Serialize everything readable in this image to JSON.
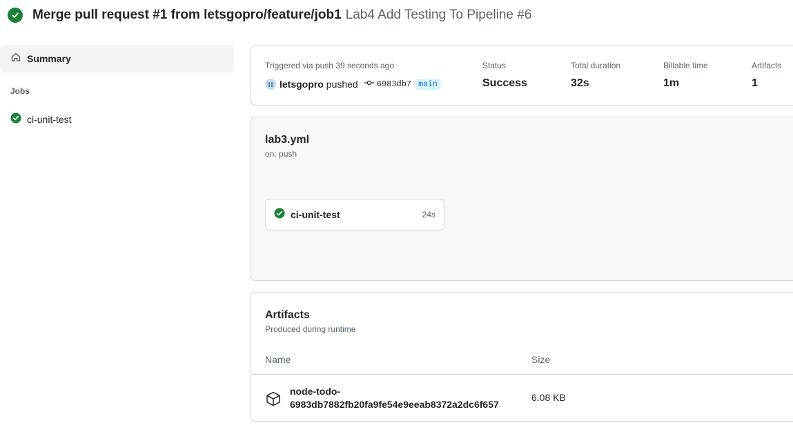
{
  "header": {
    "title": "Merge pull request #1 from letsgopro/feature/job1",
    "subtitle": "Lab4 Add Testing To Pipeline #6"
  },
  "sidebar": {
    "summary_label": "Summary",
    "jobs_heading": "Jobs",
    "jobs": [
      {
        "label": "ci-unit-test",
        "status": "success"
      }
    ]
  },
  "run_info": {
    "trigger_text": "Triggered via push 39 seconds ago",
    "actor": "letsgopro",
    "action": "pushed",
    "commit_sha": "6983db7",
    "branch": "main",
    "status_label": "Status",
    "status_value": "Success",
    "duration_label": "Total duration",
    "duration_value": "32s",
    "billable_label": "Billable time",
    "billable_value": "1m",
    "artifacts_label": "Artifacts",
    "artifacts_value": "1"
  },
  "workflow": {
    "filename": "lab3.yml",
    "trigger": "on: push",
    "job": {
      "label": "ci-unit-test",
      "duration": "24s"
    }
  },
  "artifacts": {
    "title": "Artifacts",
    "subtitle": "Produced during runtime",
    "columns": {
      "name": "Name",
      "size": "Size"
    },
    "rows": [
      {
        "name_line1": "node-todo-",
        "name_line2": "6983db7882fb20fa9fe54e9eeab8372a2dc6f657",
        "size": "6.08 KB"
      }
    ]
  },
  "colors": {
    "success": "#1a7f37",
    "link": "#0969da",
    "muted": "#59636e",
    "border": "#d1d9e0"
  },
  "icons": {
    "status": "check-circle-fill-icon",
    "home": "home-icon",
    "commit": "git-commit-icon",
    "artifact": "package-icon"
  }
}
